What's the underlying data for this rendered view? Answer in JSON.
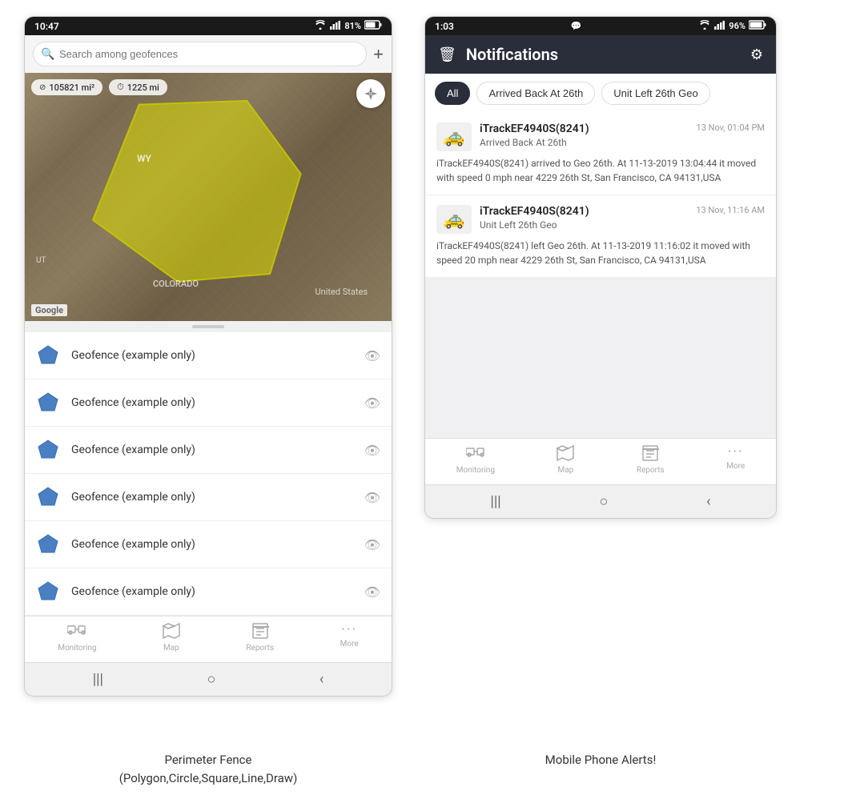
{
  "left_phone": {
    "status_bar": {
      "time": "10:47",
      "wifi": "WiFi",
      "signal": "Signal",
      "battery": "81%"
    },
    "search": {
      "placeholder": "Search among geofences"
    },
    "map": {
      "stat1": "105821 mi²",
      "stat2": "1225 mi",
      "label_wy": "WY",
      "label_us": "United States",
      "label_colorado": "COLORADO",
      "label_ut": "UT",
      "google_logo": "Google"
    },
    "geofence_items": [
      {
        "name": "Geofence (example only)"
      },
      {
        "name": "Geofence (example only)"
      },
      {
        "name": "Geofence (example only)"
      },
      {
        "name": "Geofence (example only)"
      },
      {
        "name": "Geofence (example only)"
      },
      {
        "name": "Geofence (example only)"
      }
    ],
    "bottom_nav": [
      {
        "label": "Monitoring",
        "icon": "🚌"
      },
      {
        "label": "Map",
        "icon": "🗺"
      },
      {
        "label": "Reports",
        "icon": "📊"
      },
      {
        "label": "More",
        "icon": "···"
      }
    ]
  },
  "right_phone": {
    "status_bar": {
      "time": "1:03",
      "chat_icon": "💬",
      "wifi": "WiFi",
      "signal": "Signal",
      "battery": "96%"
    },
    "header": {
      "title": "Notifications",
      "trash_label": "🗑",
      "settings_label": "⚙"
    },
    "filter_tabs": [
      {
        "label": "All",
        "active": true
      },
      {
        "label": "Arrived Back At 26th",
        "active": false
      },
      {
        "label": "Unit Left 26th Geo",
        "active": false
      }
    ],
    "notifications": [
      {
        "device": "iTrackEF4940S(8241)",
        "timestamp": "13 Nov, 01:04 PM",
        "event_type": "Arrived Back At 26th",
        "body": "iTrackEF4940S(8241) arrived to Geo 26th.    At 11-13-2019 13:04:44 it moved with speed 0 mph near 4229 26th St, San Francisco, CA 94131,USA"
      },
      {
        "device": "iTrackEF4940S(8241)",
        "timestamp": "13 Nov, 11:16 AM",
        "event_type": "Unit Left 26th Geo",
        "body": "iTrackEF4940S(8241) left Geo 26th.   At 11-13-2019 11:16:02 it moved with speed 20 mph near 4229 26th St, San Francisco, CA 94131,USA"
      }
    ],
    "bottom_nav": [
      {
        "label": "Monitoring",
        "icon": "🚌"
      },
      {
        "label": "Map",
        "icon": "🗺"
      },
      {
        "label": "Reports",
        "icon": "📊"
      },
      {
        "label": "More",
        "icon": "···"
      }
    ]
  },
  "captions": {
    "left": "Perimeter Fence\n(Polygon,Circle,Square,Line,Draw)",
    "right": "Mobile Phone Alerts!"
  }
}
